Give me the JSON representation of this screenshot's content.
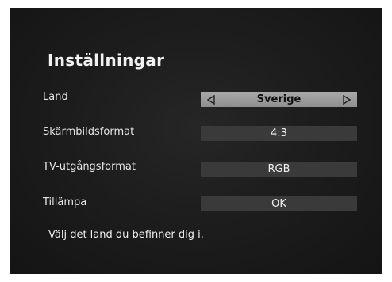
{
  "title": "Inställningar",
  "settings": [
    {
      "label": "Land",
      "value": "Sverige",
      "selected": true
    },
    {
      "label": "Skärmbildsformat",
      "value": "4:3"
    },
    {
      "label": "TV-utgångsformat",
      "value": "RGB"
    },
    {
      "label": "Tillämpa",
      "value": "OK"
    }
  ],
  "help_text": "Välj det land du befinner dig i.",
  "colors": {
    "background": "#1d1d1d",
    "field": "#3a3a3a",
    "field_selected": "#9e9e9e",
    "text": "#ffffff"
  },
  "icons": {
    "prev": "triangle-left-icon",
    "next": "triangle-right-icon"
  }
}
